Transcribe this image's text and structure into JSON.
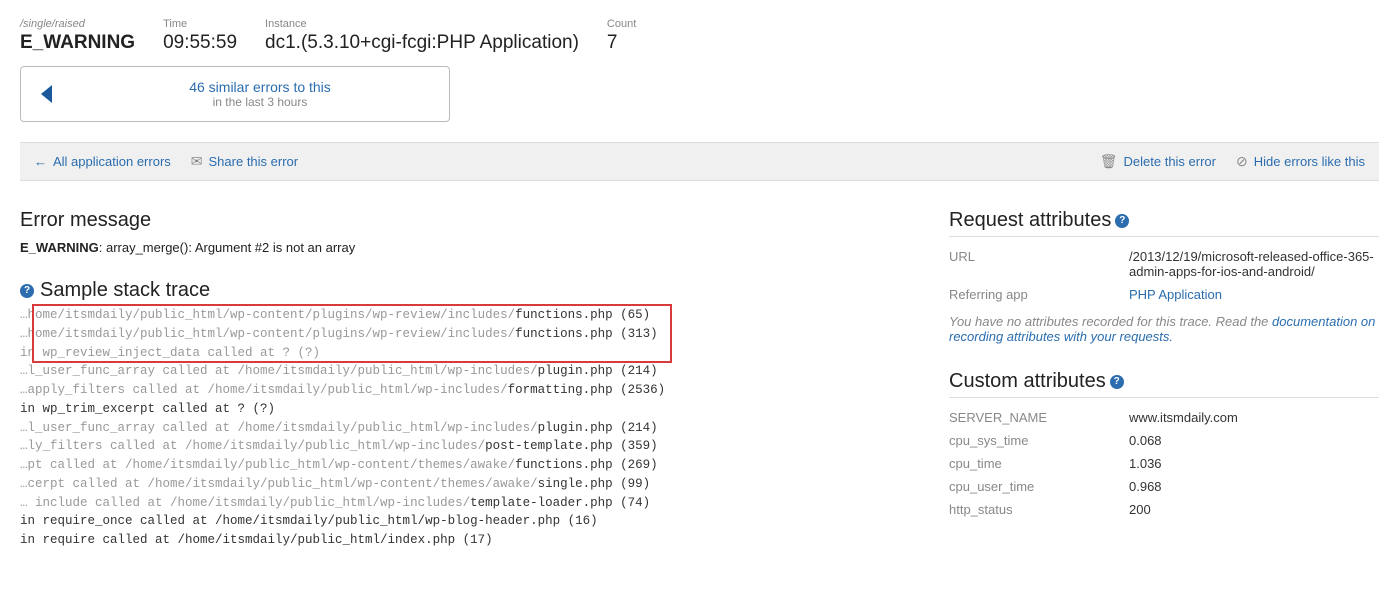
{
  "header": {
    "singleLabel": "/single/raised",
    "singleValue": "E_WARNING",
    "timeLabel": "Time",
    "timeValue": "09:55:59",
    "instanceLabel": "Instance",
    "instanceValue": "dc1.(5.3.10+cgi-fcgi:PHP Application)",
    "countLabel": "Count",
    "countValue": "7"
  },
  "similar": {
    "main": "46 similar errors to this",
    "sub": "in the last 3 hours"
  },
  "actions": {
    "allErrors": "All application errors",
    "share": "Share this error",
    "delete": "Delete this error",
    "hide": "Hide errors like this"
  },
  "error": {
    "title": "Error message",
    "type": "E_WARNING",
    "msg": ": array_merge(): Argument #2 is not an array"
  },
  "stack": {
    "title": "Sample stack trace",
    "lines": [
      {
        "pre": "…home/itsmdaily/public_html/wp-content/plugins/wp-review/includes/",
        "hl": "functions.php (65)"
      },
      {
        "pre": "…home/itsmdaily/public_html/wp-content/plugins/wp-review/includes/",
        "hl": "functions.php (313)"
      },
      {
        "pre": "in wp_review_inject_data called at ? (?)",
        "hl": ""
      },
      {
        "pre": "…l_user_func_array called at /home/itsmdaily/public_html/wp-includes/",
        "hl": "plugin.php (214)"
      },
      {
        "pre": "…apply_filters called at /home/itsmdaily/public_html/wp-includes/",
        "hl": "formatting.php (2536)"
      },
      {
        "pre": "",
        "hl": "in wp_trim_excerpt called at ? (?)"
      },
      {
        "pre": "…l_user_func_array called at /home/itsmdaily/public_html/wp-includes/",
        "hl": "plugin.php (214)"
      },
      {
        "pre": "…ly_filters called at /home/itsmdaily/public_html/wp-includes/",
        "hl": "post-template.php (359)"
      },
      {
        "pre": "…pt called at /home/itsmdaily/public_html/wp-content/themes/awake/",
        "hl": "functions.php (269)"
      },
      {
        "pre": "…cerpt called at /home/itsmdaily/public_html/wp-content/themes/awake/",
        "hl": "single.php (99)"
      },
      {
        "pre": "… include called at /home/itsmdaily/public_html/wp-includes/",
        "hl": "template-loader.php (74)"
      },
      {
        "pre": "",
        "hl": "in require_once called at /home/itsmdaily/public_html/wp-blog-header.php (16)"
      },
      {
        "pre": "",
        "hl": "in require called at /home/itsmdaily/public_html/index.php (17)"
      }
    ]
  },
  "request": {
    "title": "Request attributes",
    "rows": [
      {
        "key": "URL",
        "val": "/2013/12/19/microsoft-released-office-365-admin-apps-for-ios-and-android/",
        "link": false
      },
      {
        "key": "Referring app",
        "val": "PHP Application",
        "link": true
      }
    ],
    "note1": "You have no attributes recorded for this trace. Read the ",
    "noteLink": "documentation on recording attributes with your requests."
  },
  "custom": {
    "title": "Custom attributes",
    "rows": [
      {
        "key": "SERVER_NAME",
        "val": "www.itsmdaily.com"
      },
      {
        "key": "cpu_sys_time",
        "val": "0.068"
      },
      {
        "key": "cpu_time",
        "val": "1.036"
      },
      {
        "key": "cpu_user_time",
        "val": "0.968"
      },
      {
        "key": "http_status",
        "val": "200"
      }
    ]
  }
}
